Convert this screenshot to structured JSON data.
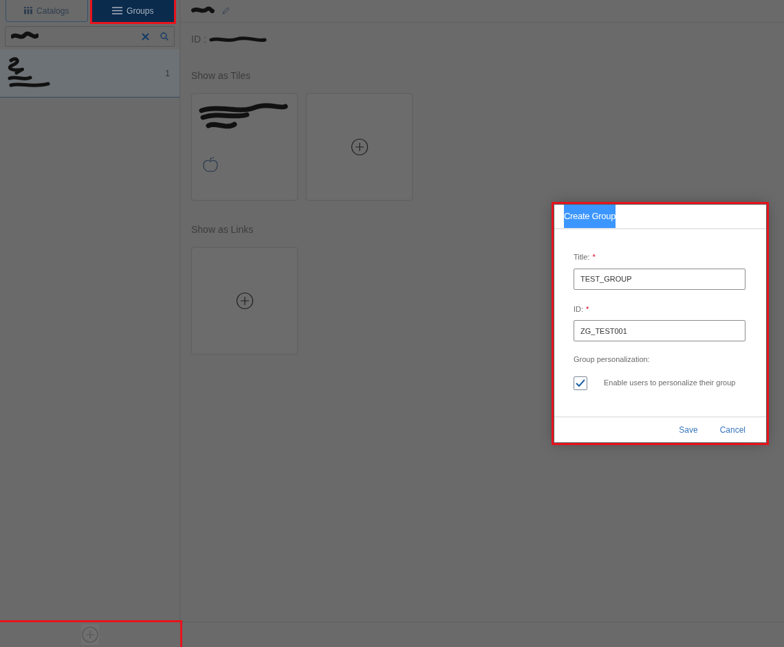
{
  "sidebar": {
    "tabs": [
      {
        "label": "Catalogs",
        "selected": false,
        "highlighted": false
      },
      {
        "label": "Groups",
        "selected": true,
        "highlighted": true
      }
    ],
    "groups": [
      {
        "count": "1",
        "selected": true
      }
    ],
    "add_button": {
      "highlighted": true
    }
  },
  "content": {
    "id_label": "ID :",
    "sections": [
      {
        "title": "Show as Tiles",
        "tiles": [
          {
            "kind": "app"
          },
          {
            "kind": "add"
          }
        ]
      },
      {
        "title": "Show as Links",
        "tiles": [
          {
            "kind": "add"
          }
        ]
      }
    ]
  },
  "dialog": {
    "title": "Create Group",
    "highlighted": true,
    "fields": [
      {
        "label": "Title:",
        "required_mark": "*",
        "value": "TEST_GROUP"
      },
      {
        "label": "ID:",
        "required_mark": "*",
        "value": "ZG_TEST001"
      }
    ],
    "personalization": {
      "label": "Group personalization:",
      "checkbox_label": "Enable users to personalize their group",
      "checked": true
    },
    "buttons": [
      "Save",
      "Cancel"
    ]
  }
}
